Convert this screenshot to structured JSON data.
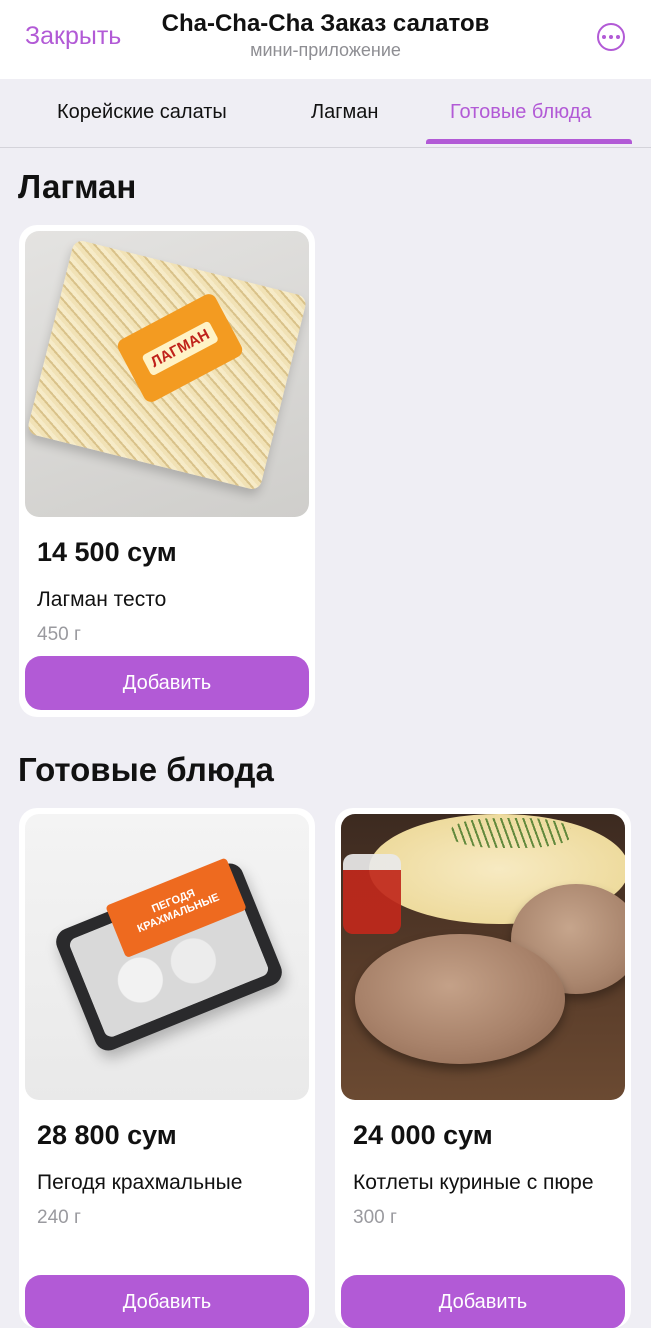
{
  "header": {
    "close_label": "Закрыть",
    "title": "Cha-Cha-Cha Заказ салатов",
    "subtitle": "мини-приложение"
  },
  "tabs": [
    {
      "label": "Корейские салаты",
      "active": false
    },
    {
      "label": "Лагман",
      "active": false
    },
    {
      "label": "Готовые блюда",
      "active": true
    }
  ],
  "accent_color": "#b25ad6",
  "sections": [
    {
      "title": "Лагман",
      "products": [
        {
          "price": "14 500 сум",
          "name": "Лагман тесто",
          "weight": "450 г",
          "add_label": "Добавить",
          "image": "lagman-pack-image",
          "pack_text": "ЛАГМАН"
        }
      ]
    },
    {
      "title": "Готовые блюда",
      "products": [
        {
          "price": "28 800 сум",
          "name": "Пегодя крахмальные",
          "weight": "240 г",
          "add_label": "Добавить",
          "image": "pegodya-tray-image",
          "pack_text": "ПЕГОДЯ КРАХМАЛЬНЫЕ"
        },
        {
          "price": "24 000 сум",
          "name": "Котлеты куриные с пюре",
          "weight": "300 г",
          "add_label": "Добавить",
          "image": "cutlets-puree-image"
        }
      ]
    }
  ]
}
